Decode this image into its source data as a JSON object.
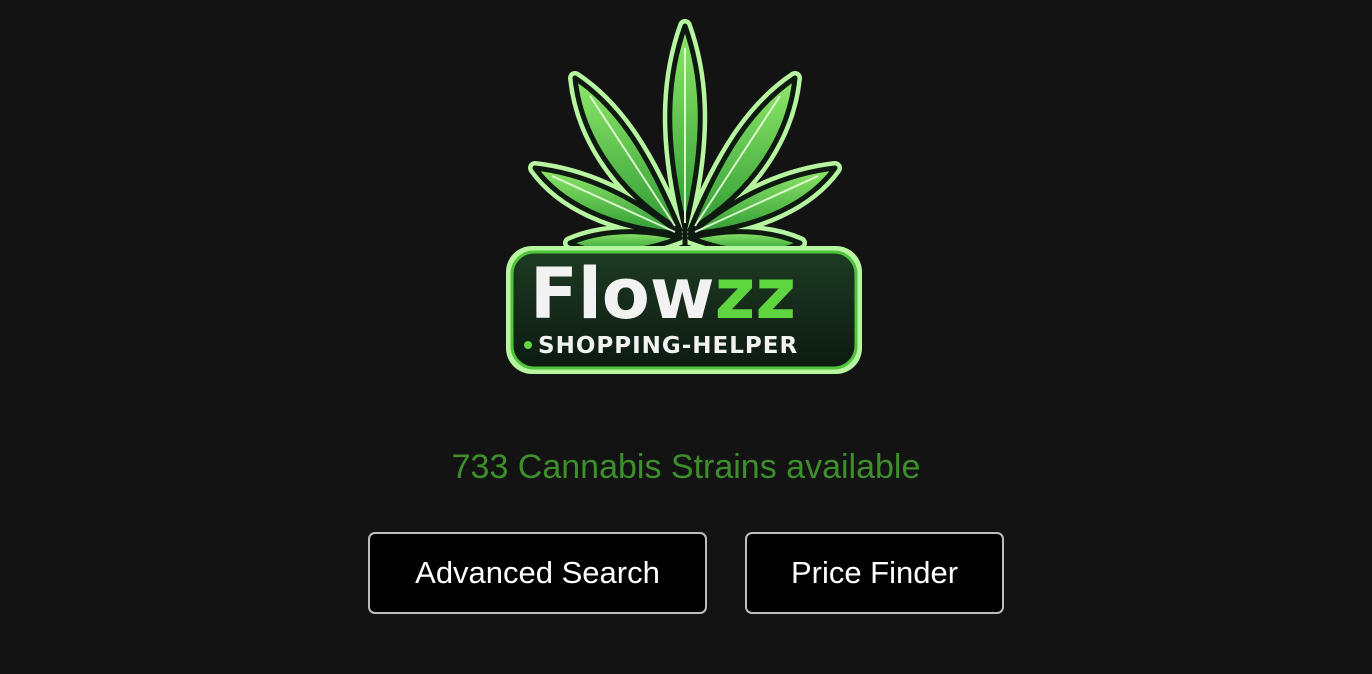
{
  "logo": {
    "icon": "cannabis-leaf-icon",
    "brand_white": "Flow",
    "brand_green": "zz",
    "tagline": "SHOPPING-HELPER",
    "colors": {
      "leaf_green": "#5fce3c",
      "leaf_dark": "#1f7a2a",
      "outline": "#7ee06a",
      "badge_bg": "#13251a"
    }
  },
  "status": {
    "strain_count_text": "733 Cannabis Strains available",
    "color": "#3c8f2a"
  },
  "actions": {
    "advanced_search_label": "Advanced Search",
    "price_finder_label": "Price Finder"
  }
}
